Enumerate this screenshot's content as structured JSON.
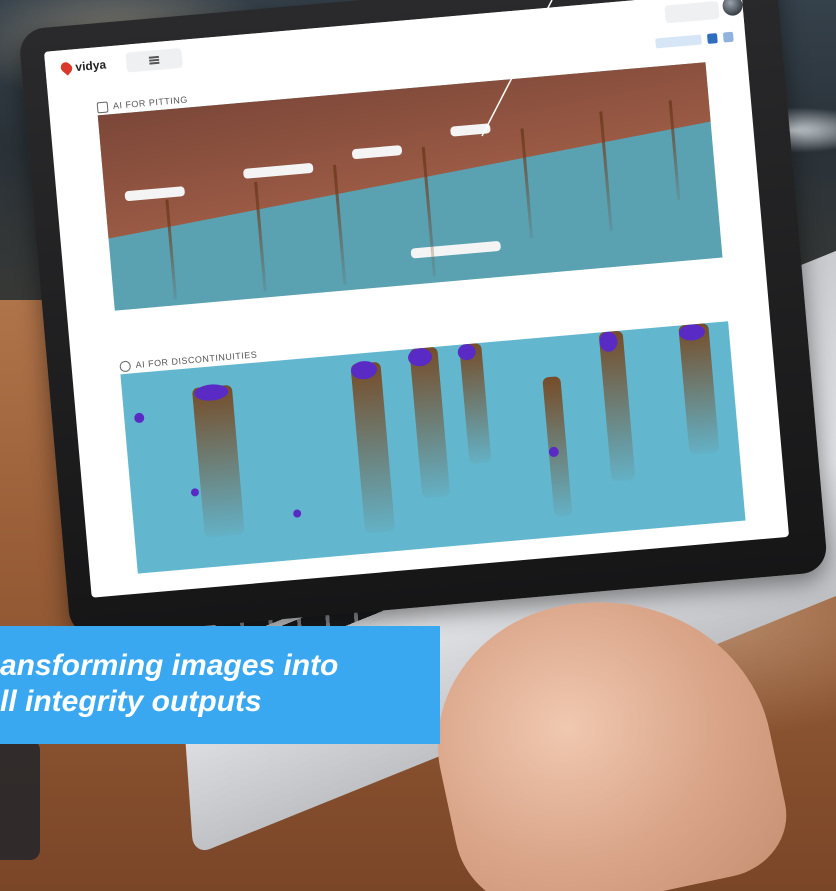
{
  "app": {
    "logo_text": "vidya"
  },
  "sections": [
    {
      "title": "AI FOR PITTING",
      "icon": "image-icon"
    },
    {
      "title": "AI FOR DISCONTINUITIES",
      "icon": "circle-icon"
    }
  ],
  "caption": {
    "text": "ansforming images into\nll integrity outputs"
  },
  "colors": {
    "caption_bg": "#3aa8f0",
    "steel_blue": "#62b7cf",
    "rust": "#7a4638",
    "defect_marker": "#5a2ac4"
  }
}
